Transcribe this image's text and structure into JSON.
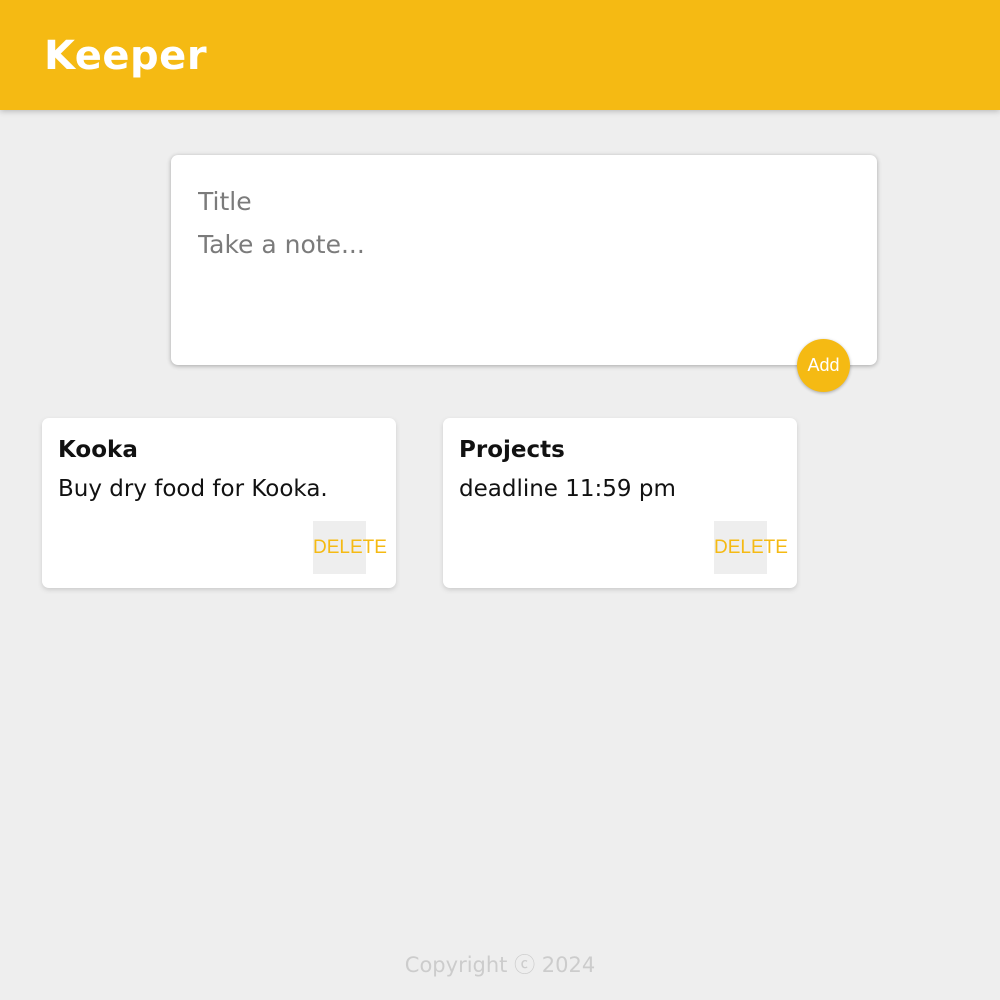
{
  "app": {
    "title": "Keeper",
    "accent_color": "#f5ba13",
    "background_color": "#eeeeee"
  },
  "compose": {
    "title_placeholder": "Title",
    "content_placeholder": "Take a note...",
    "add_label": "Add"
  },
  "notes": [
    {
      "title": "Kooka",
      "content": "Buy dry food for Kooka.",
      "delete_label": "DELETE"
    },
    {
      "title": "Projects",
      "content": "deadline 11:59 pm",
      "delete_label": "DELETE"
    }
  ],
  "footer": {
    "copyright": "Copyright ⓒ 2024"
  }
}
